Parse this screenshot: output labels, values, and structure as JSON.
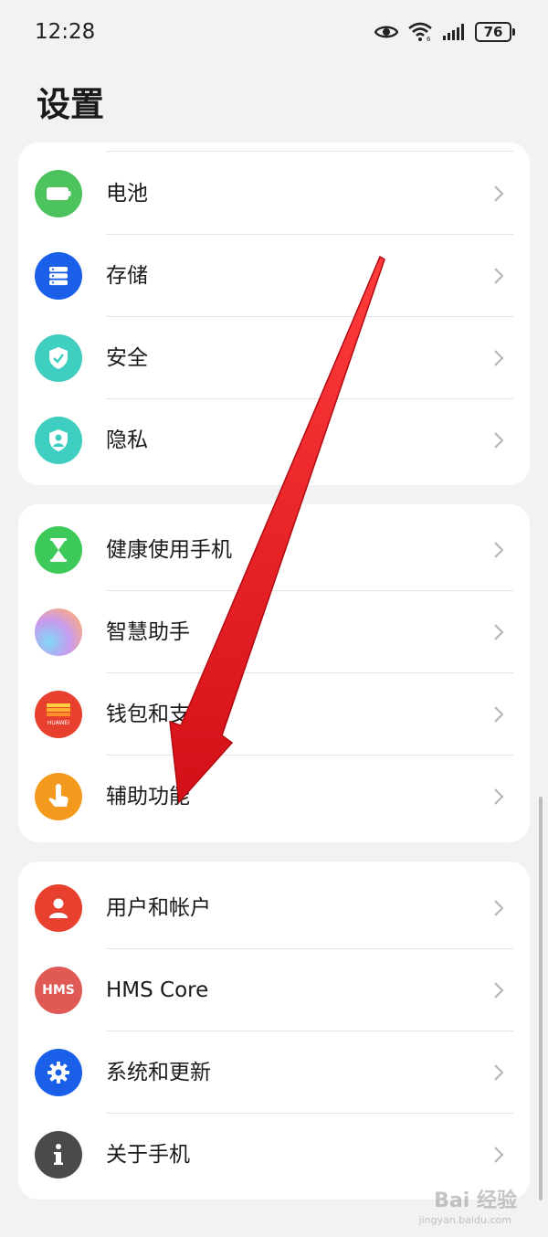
{
  "status_bar": {
    "time": "12:28",
    "battery_level": "76",
    "icons": [
      "eye-icon",
      "wifi-icon",
      "signal-icon",
      "battery-icon"
    ]
  },
  "page": {
    "title": "设置"
  },
  "groups": [
    {
      "items": [
        {
          "label": "电池",
          "icon": "battery-icon",
          "color": "#4cc35d"
        },
        {
          "label": "存储",
          "icon": "storage-icon",
          "color": "#1a5fe8"
        },
        {
          "label": "安全",
          "icon": "shield-check-icon",
          "color": "#3fcfc0"
        },
        {
          "label": "隐私",
          "icon": "privacy-shield-icon",
          "color": "#3fcfc0"
        }
      ]
    },
    {
      "items": [
        {
          "label": "健康使用手机",
          "icon": "hourglass-icon",
          "color": "#3ec95b"
        },
        {
          "label": "智慧助手",
          "icon": "assistant-orb-icon",
          "color": "#c79bf0"
        },
        {
          "label": "钱包和支付",
          "icon": "wallet-icon",
          "color": "#e8402f",
          "icon_text": "HUAWEI"
        },
        {
          "label": "辅助功能",
          "icon": "touch-hand-icon",
          "color": "#f39a1e"
        }
      ]
    },
    {
      "items": [
        {
          "label": "用户和帐户",
          "icon": "user-icon",
          "color": "#e8402f"
        },
        {
          "label": "HMS Core",
          "icon": "hms-icon",
          "color": "#e05a55",
          "icon_text": "HMS"
        },
        {
          "label": "系统和更新",
          "icon": "gear-icon",
          "color": "#1a5fe8"
        },
        {
          "label": "关于手机",
          "icon": "info-icon",
          "color": "#4a4a4a"
        }
      ]
    }
  ],
  "watermark": {
    "text": "Bai 经验",
    "subtext": "jingyan.baidu.com"
  },
  "annotation": {
    "arrow_color": "#e8141c",
    "target": "辅助功能"
  }
}
